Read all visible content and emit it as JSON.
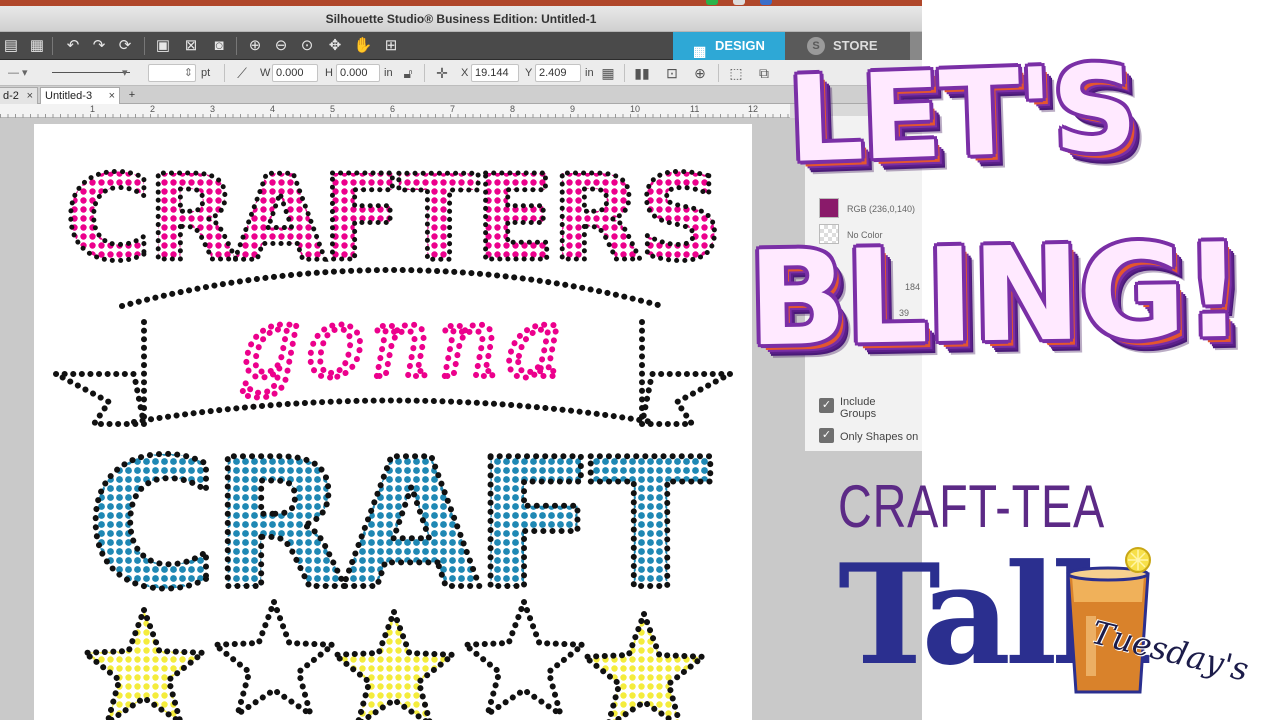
{
  "window": {
    "title": "Silhouette Studio® Business Edition: Untitled-1"
  },
  "top_tabs": {
    "design": "DESIGN",
    "store": "STORE"
  },
  "properties_bar": {
    "unit_pt": "pt",
    "w_label": "W",
    "w_value": "0.000",
    "h_label": "H",
    "h_value": "0.000",
    "unit_in": "in",
    "x_label": "X",
    "x_value": "19.144",
    "y_label": "Y",
    "y_value": "2.409",
    "unit_in2": "in"
  },
  "document_tabs": [
    {
      "label": "d-2",
      "close": "×"
    },
    {
      "label": "Untitled-3",
      "close": "×"
    }
  ],
  "add_tab": "+",
  "ruler": {
    "numbers": [
      "1",
      "2",
      "3",
      "4",
      "5",
      "6",
      "7",
      "8",
      "9",
      "10",
      "11",
      "12"
    ]
  },
  "panel": {
    "swatch_label": "RGB (236,0,140)",
    "no_color": "No Color",
    "partial_1": "184",
    "partial_2": "39",
    "include_groups": "Include Groups",
    "only_shapes": "Only Shapes on"
  },
  "design": {
    "line1": "CRAFTERS",
    "line2": "gonna",
    "line3": "CRAFT",
    "colors": {
      "pink": "#ec008c",
      "blue": "#1f88b4",
      "yellow": "#f4ec3c",
      "black": "#111111"
    }
  },
  "overlay": {
    "lets": "LET'S",
    "bling": "BLING!",
    "craft_tea": "CRAFT-TEA",
    "talk": "Talk",
    "tuesdays": "Tuesday's"
  },
  "colors": {
    "accent": "#2ea8d6",
    "title_purple": "#7a2fa6",
    "talk_blue": "#2b2f8f"
  }
}
